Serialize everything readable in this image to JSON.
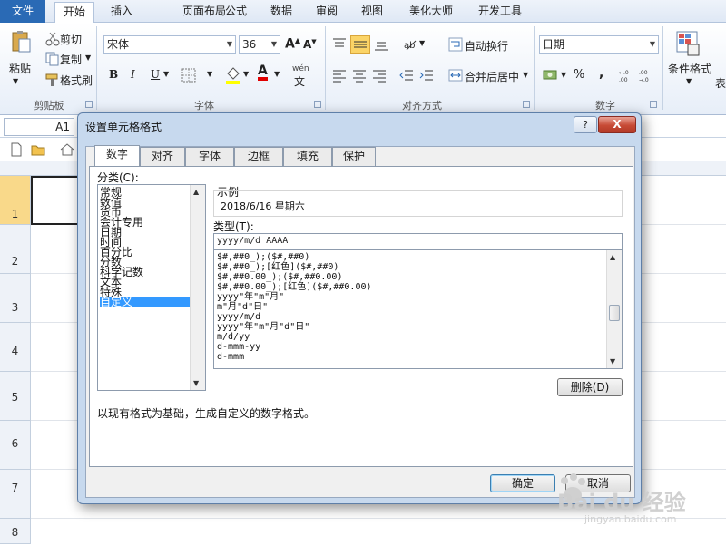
{
  "ribbon": {
    "tabs": [
      "文件",
      "开始",
      "插入",
      "页面布局",
      "公式",
      "数据",
      "审阅",
      "视图",
      "美化大师",
      "开发工具"
    ],
    "clipboard": {
      "paste": "粘贴",
      "cut": "剪切",
      "copy": "复制",
      "format_painter": "格式刷",
      "label": "剪贴板"
    },
    "font": {
      "name": "宋体",
      "size": "36",
      "bold": "B",
      "italic": "I",
      "underline": "U",
      "label": "字体",
      "font_color_letter": "A",
      "wen": "wén"
    },
    "alignment": {
      "wrap": "自动换行",
      "merge": "合并后居中",
      "label": "对齐方式"
    },
    "number": {
      "format": "日期",
      "percent": "%",
      "comma": ",",
      "label": "数字"
    },
    "styles": {
      "conditional": "条件格式",
      "table": "表"
    }
  },
  "formula_bar": {
    "name_box": "A1"
  },
  "sheet": {
    "rows": [
      "1",
      "2",
      "3",
      "4",
      "5",
      "6",
      "7",
      "8"
    ]
  },
  "dialog": {
    "title": "设置单元格格式",
    "help": "?",
    "close": "X",
    "tabs": [
      "数字",
      "对齐",
      "字体",
      "边框",
      "填充",
      "保护"
    ],
    "category_label": "分类(C):",
    "categories": [
      "常规",
      "数值",
      "货币",
      "会计专用",
      "日期",
      "时间",
      "百分比",
      "分数",
      "科学记数",
      "文本",
      "特殊",
      "自定义"
    ],
    "sample_label": "示例",
    "sample_value": "2018/6/16 星期六",
    "type_label": "类型(T):",
    "type_value": "yyyy/m/d AAAA",
    "formats": [
      "$#,##0_);($#,##0)",
      "$#,##0_);[红色]($#,##0)",
      "$#,##0.00_);($#,##0.00)",
      "$#,##0.00_);[红色]($#,##0.00)",
      "yyyy\"年\"m\"月\"",
      "m\"月\"d\"日\"",
      "yyyy/m/d",
      "yyyy\"年\"m\"月\"d\"日\"",
      "m/d/yy",
      "d-mmm-yy",
      "d-mmm"
    ],
    "delete_button": "删除(D)",
    "description": "以现有格式为基础，生成自定义的数字格式。",
    "ok_button": "确定",
    "cancel_button": "取消"
  },
  "watermark": {
    "brand": "Bai du 经验",
    "url": "jingyan.baidu.com"
  }
}
